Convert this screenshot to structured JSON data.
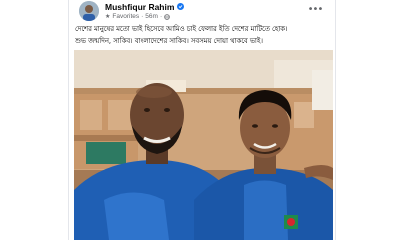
{
  "post": {
    "author": "Mushfiqur Rahim",
    "audience": "Favorites",
    "separator": "·",
    "time": "56m",
    "text_lines": [
      "দেশের মানুষের মতো ভাই হিসেবে আমিও চাই ফেলার ইতি দেশের মাটিতে হোক।",
      "শুভ জন্মদিন, সাকিব। বাংলাদেশের সাকিব। সবসময় দোয়া থাকবে ভাই।"
    ]
  },
  "icons": {
    "verified": "verified-badge-icon",
    "favorites": "star-icon",
    "audience": "globe-icon",
    "more": "more-options-icon"
  },
  "colors": {
    "verified_blue": "#1877f2",
    "meta_gray": "#65676b",
    "jersey_blue": "#1f5fb4"
  }
}
